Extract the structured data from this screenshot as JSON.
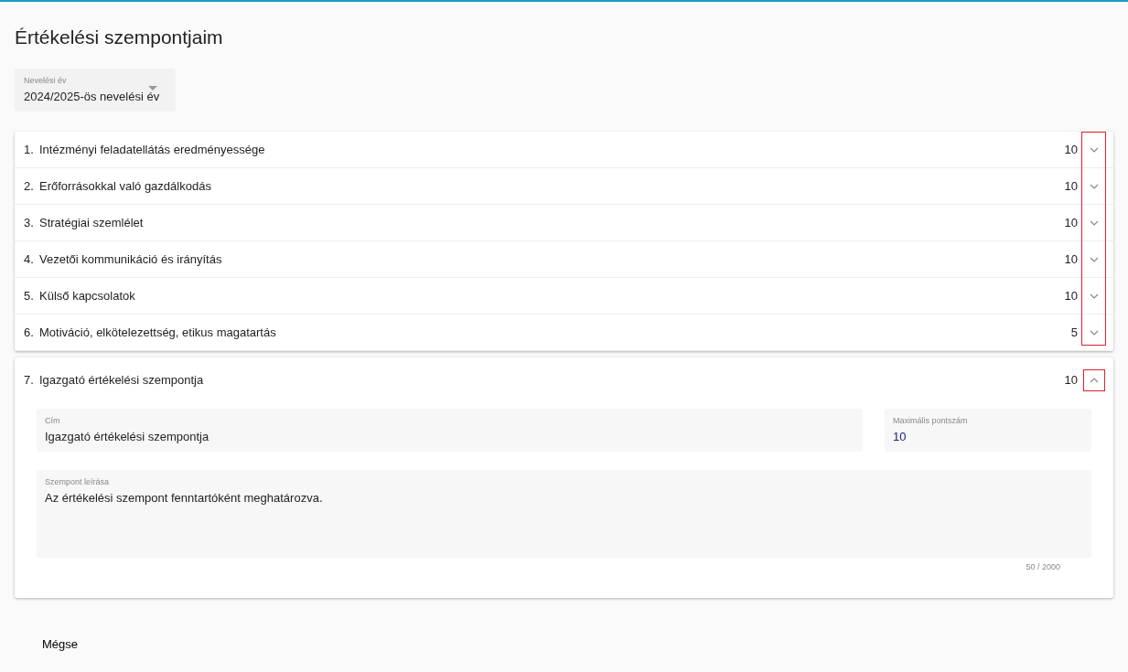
{
  "title": "Értékelési szempontjaim",
  "year_select": {
    "label": "Nevelési év",
    "value": "2024/2025-ös nevelési év"
  },
  "groups": [
    {
      "items": [
        {
          "number": "1.",
          "title": "Intézményi feladatellátás eredményessége",
          "score": "10",
          "expanded": false
        },
        {
          "number": "2.",
          "title": "Erőforrásokkal való gazdálkodás",
          "score": "10",
          "expanded": false
        },
        {
          "number": "3.",
          "title": "Stratégiai szemlélet",
          "score": "10",
          "expanded": false
        },
        {
          "number": "4.",
          "title": "Vezetői kommunikáció és irányítás",
          "score": "10",
          "expanded": false
        },
        {
          "number": "5.",
          "title": "Külső kapcsolatok",
          "score": "10",
          "expanded": false
        },
        {
          "number": "6.",
          "title": "Motiváció, elkötelezettség, etikus magatartás",
          "score": "5",
          "expanded": false
        }
      ]
    },
    {
      "items": [
        {
          "number": "7.",
          "title": "Igazgató értékelési szempontja",
          "score": "10",
          "expanded": true,
          "details": {
            "title_field": {
              "label": "Cím",
              "value": "Igazgató értékelési szempontja"
            },
            "max_field": {
              "label": "Maximális pontszám",
              "value": "10"
            },
            "description": {
              "label": "Szempont leírása",
              "value": "Az értékelési szempont fenntartóként meghatározva.",
              "counter": "50 / 2000"
            }
          }
        }
      ]
    }
  ],
  "cancel_button": "Mégse"
}
